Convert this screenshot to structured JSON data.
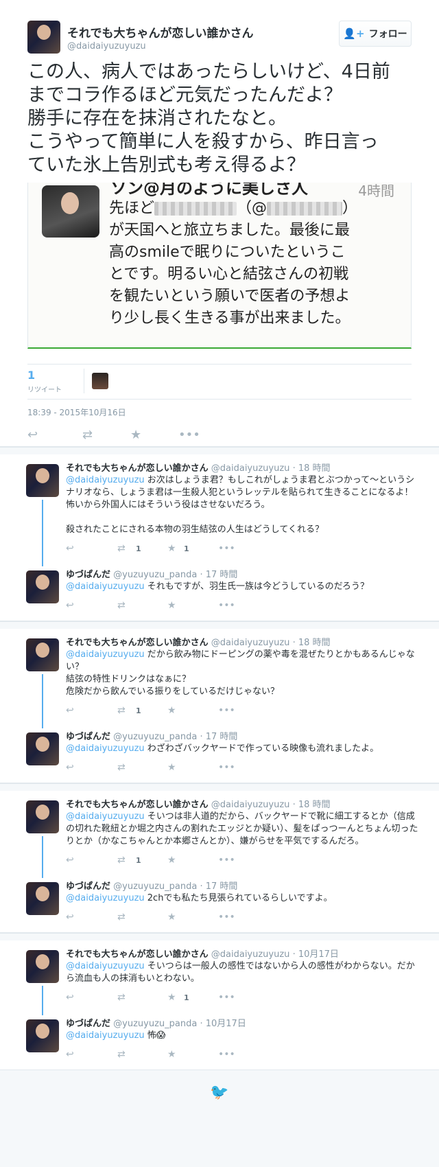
{
  "main": {
    "user_name": "それでも大ちゃんが恋しい誰かさん",
    "user_handle": "@daidaiyuzuyuzu",
    "follow_label": "フォロー",
    "text": "この人、病人ではあったらしいけど、4日前\nまでコラ作るほど元気だったんだよ？\n勝手に存在を抹消されたなと。\nこうやって簡単に人を殺すから、昨日言っ\nていた氷上告別式も考え得るよ？",
    "embed": {
      "name": "ソン@月のように美しさ人",
      "time": "4時間",
      "line1_a": "先ほど",
      "line1_b": "（@",
      "line1_c": "）",
      "body": "が天国へと旅立ちました。最後に最\n高のsmileで眠りについたというこ\nとです。明るい心と結弦さんの初戦\nを観たいという願いで医者の予想よ\nり少し長く生きる事が出来ました。"
    },
    "retweet_count": "1",
    "retweet_label": "リツイート",
    "date": "18:39 - 2015年10月16日"
  },
  "conversations": [
    {
      "r1": {
        "name": "それでも大ちゃんが恋しい誰かさん",
        "handle": "@daidaiyuzuyuzu",
        "time": "· 18 時間",
        "at": "@daidaiyuzuyuzu",
        "text": " お次はしょうま君？もしこれがしょうま君とぶつかって～というシナリオなら、しょうま君は一生殺人犯というレッテルを貼られて生きることになるよ！\n怖いから外国人にはそういう役はさせないだろう。\n\n殺されたことにされる本物の羽生結弦の人生はどうしてくれる？",
        "rt": "1",
        "fav": "1"
      },
      "r2": {
        "name": "ゆづぱんだ",
        "handle": "@yuzuyuzu_panda",
        "time": "· 17 時間",
        "at": "@daidaiyuzuyuzu",
        "text": " それもですが、羽生氏一族は今どうしているのだろう？",
        "rt": "",
        "fav": ""
      }
    },
    {
      "r1": {
        "name": "それでも大ちゃんが恋しい誰かさん",
        "handle": "@daidaiyuzuyuzu",
        "time": "· 18 時間",
        "at": "@daidaiyuzuyuzu",
        "text": " だから飲み物にドーピングの薬や毒を混ぜたりとかもあるんじゃない？\n結弦の特性ドリンクはなぁに？\n危険だから飲んでいる振りをしているだけじゃない？",
        "rt": "1",
        "fav": ""
      },
      "r2": {
        "name": "ゆづぱんだ",
        "handle": "@yuzuyuzu_panda",
        "time": "· 17 時間",
        "at": "@daidaiyuzuyuzu",
        "text": " わざわざバックヤードで作っている映像も流れましたよ。",
        "rt": "",
        "fav": ""
      }
    },
    {
      "r1": {
        "name": "それでも大ちゃんが恋しい誰かさん",
        "handle": "@daidaiyuzuyuzu",
        "time": "· 18 時間",
        "at": "@daidaiyuzuyuzu",
        "text": " そいつは非人道的だから、バックヤードで靴に細工するとか（信成の切れた靴紐とか堀之内さんの割れたエッジとか疑い）、髪をぱっつーんとちょん切ったりとか（かなこちゃんとか本郷さんとか）、嫌がらせを平気でするんだろ。",
        "rt": "1",
        "fav": ""
      },
      "r2": {
        "name": "ゆづぱんだ",
        "handle": "@yuzuyuzu_panda",
        "time": "· 17 時間",
        "at": "@daidaiyuzuyuzu",
        "text": " 2chでも私たち見張られているらしいですよ。",
        "rt": "",
        "fav": ""
      }
    },
    {
      "r1": {
        "name": "それでも大ちゃんが恋しい誰かさん",
        "handle": "@daidaiyuzuyuzu",
        "time": "· 10月17日",
        "at": "@daidaiyuzuyuzu",
        "text": " そいつらは一般人の感性ではないから人の感性がわからない。だから流血も人の抹消もいとわない。",
        "rt": "",
        "fav": "1"
      },
      "r2": {
        "name": "ゆづぱんだ",
        "handle": "@yuzuyuzu_panda",
        "time": "· 10月17日",
        "at": "@daidaiyuzuyuzu",
        "text": " 怖😱",
        "rt": "",
        "fav": ""
      }
    }
  ],
  "icons": {
    "reply": "reply-icon",
    "retweet": "retweet-icon",
    "favorite": "star-icon",
    "more": "more-icon",
    "footer": "twitter-bird-icon"
  }
}
